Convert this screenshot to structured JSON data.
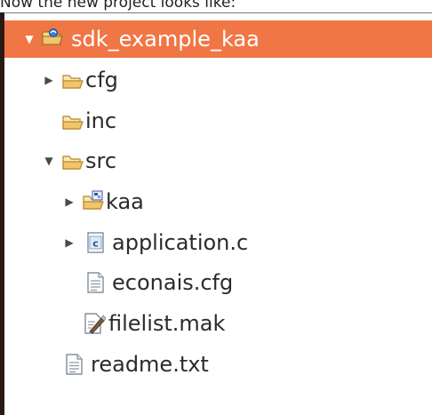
{
  "caption": "Now the new project looks like:",
  "tree": {
    "root": {
      "label": "sdk_example_kaa",
      "toggle": "▼",
      "icon": "project-folder-icon"
    },
    "items": [
      {
        "label": "cfg",
        "toggle": "▶",
        "icon": "folder-icon"
      },
      {
        "label": "inc",
        "toggle": "",
        "icon": "folder-icon"
      },
      {
        "label": "src",
        "toggle": "▼",
        "icon": "folder-icon"
      },
      {
        "label": "kaa",
        "toggle": "▶",
        "icon": "package-folder-icon"
      },
      {
        "label": "application.c",
        "toggle": "▶",
        "icon": "c-file-icon"
      },
      {
        "label": "econais.cfg",
        "toggle": "",
        "icon": "text-file-icon"
      },
      {
        "label": "filelist.mak",
        "toggle": "",
        "icon": "makefile-icon"
      },
      {
        "label": "readme.txt",
        "toggle": "",
        "icon": "text-file-icon"
      }
    ]
  },
  "colors": {
    "selection": "#f07645",
    "folder": "#f2c46c",
    "folder_stroke": "#b8862b",
    "border": "#2a1a14"
  }
}
